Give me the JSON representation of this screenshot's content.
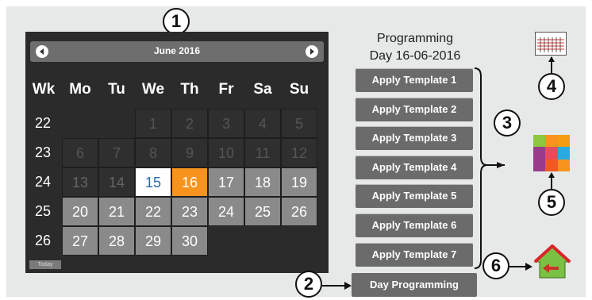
{
  "callouts": [
    "1",
    "2",
    "3",
    "4",
    "5",
    "6"
  ],
  "calendar": {
    "month_title": "June 2016",
    "week_label": "Wk",
    "day_headers": [
      "Mo",
      "Tu",
      "We",
      "Th",
      "Fr",
      "Sa",
      "Su"
    ],
    "weeks": [
      {
        "wk": "22",
        "days": [
          "",
          "",
          "1",
          "2",
          "3",
          "4",
          "5"
        ]
      },
      {
        "wk": "23",
        "days": [
          "6",
          "7",
          "8",
          "9",
          "10",
          "11",
          "12"
        ]
      },
      {
        "wk": "24",
        "days": [
          "13",
          "14",
          "15",
          "16",
          "17",
          "18",
          "19"
        ]
      },
      {
        "wk": "25",
        "days": [
          "20",
          "21",
          "22",
          "23",
          "24",
          "25",
          "26"
        ]
      },
      {
        "wk": "26",
        "days": [
          "27",
          "28",
          "29",
          "30",
          "",
          "",
          ""
        ]
      }
    ],
    "today_date": "15",
    "selected_date": "16",
    "today_button": "Today"
  },
  "programming": {
    "title_line1": "Programming",
    "title_line2": "Day 16-06-2016"
  },
  "templates": [
    "Apply Template 1",
    "Apply Template 2",
    "Apply Template 3",
    "Apply Template 4",
    "Apply Template 5",
    "Apply Template 6",
    "Apply Template 7"
  ],
  "day_programming_button": "Day Programming",
  "colors": {
    "selected": "#f7941d",
    "today_text": "#2a6cb0",
    "button_bg": "#6b6b6b",
    "home_green": "#7ac143",
    "home_red": "#d9252a"
  },
  "icons": [
    "prev-arrow-icon",
    "next-arrow-icon",
    "schedule-grid-icon",
    "color-palette-icon",
    "home-icon"
  ]
}
